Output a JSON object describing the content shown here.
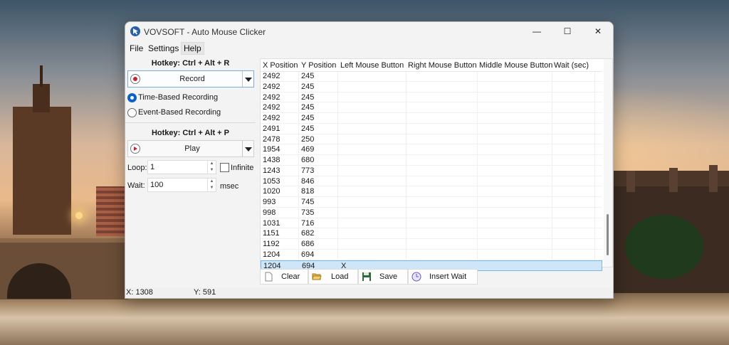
{
  "window": {
    "title": "VOVSOFT - Auto Mouse Clicker",
    "min": "—",
    "max": "☐",
    "close": "✕"
  },
  "menu": [
    "File",
    "Settings",
    "Help"
  ],
  "record": {
    "hotkey": "Hotkey: Ctrl + Alt + R",
    "button": "Record"
  },
  "mode": {
    "time": "Time-Based Recording",
    "event": "Event-Based Recording",
    "selected": "time"
  },
  "play": {
    "hotkey": "Hotkey: Ctrl + Alt + P",
    "button": "Play"
  },
  "loop": {
    "label": "Loop:",
    "value": "1",
    "infinite_label": "Infinite",
    "infinite_checked": false
  },
  "wait": {
    "label": "Wait:",
    "value": "100",
    "unit": "msec"
  },
  "table": {
    "columns": [
      "X Position",
      "Y Position",
      "Left Mouse Button",
      "Right Mouse Button",
      "Middle Mouse Button",
      "Wait (sec)"
    ],
    "rows": [
      [
        "2492",
        "245",
        "",
        "",
        "",
        ""
      ],
      [
        "2492",
        "245",
        "",
        "",
        "",
        ""
      ],
      [
        "2492",
        "245",
        "",
        "",
        "",
        ""
      ],
      [
        "2492",
        "245",
        "",
        "",
        "",
        ""
      ],
      [
        "2492",
        "245",
        "",
        "",
        "",
        ""
      ],
      [
        "2491",
        "245",
        "",
        "",
        "",
        ""
      ],
      [
        "2478",
        "250",
        "",
        "",
        "",
        ""
      ],
      [
        "1954",
        "469",
        "",
        "",
        "",
        ""
      ],
      [
        "1438",
        "680",
        "",
        "",
        "",
        ""
      ],
      [
        "1243",
        "773",
        "",
        "",
        "",
        ""
      ],
      [
        "1053",
        "846",
        "",
        "",
        "",
        ""
      ],
      [
        "1020",
        "818",
        "",
        "",
        "",
        ""
      ],
      [
        "993",
        "745",
        "",
        "",
        "",
        ""
      ],
      [
        "998",
        "735",
        "",
        "",
        "",
        ""
      ],
      [
        "1031",
        "716",
        "",
        "",
        "",
        ""
      ],
      [
        "1151",
        "682",
        "",
        "",
        "",
        ""
      ],
      [
        "1192",
        "686",
        "",
        "",
        "",
        ""
      ],
      [
        "1204",
        "694",
        "",
        "",
        "",
        ""
      ],
      [
        "1204",
        "694",
        "X",
        "",
        "",
        ""
      ]
    ],
    "selected_row": 18
  },
  "toolbar": {
    "clear": "Clear",
    "load": "Load",
    "save": "Save",
    "insert_wait": "Insert Wait"
  },
  "status": {
    "x": "X: 1308",
    "y": "Y: 591"
  }
}
